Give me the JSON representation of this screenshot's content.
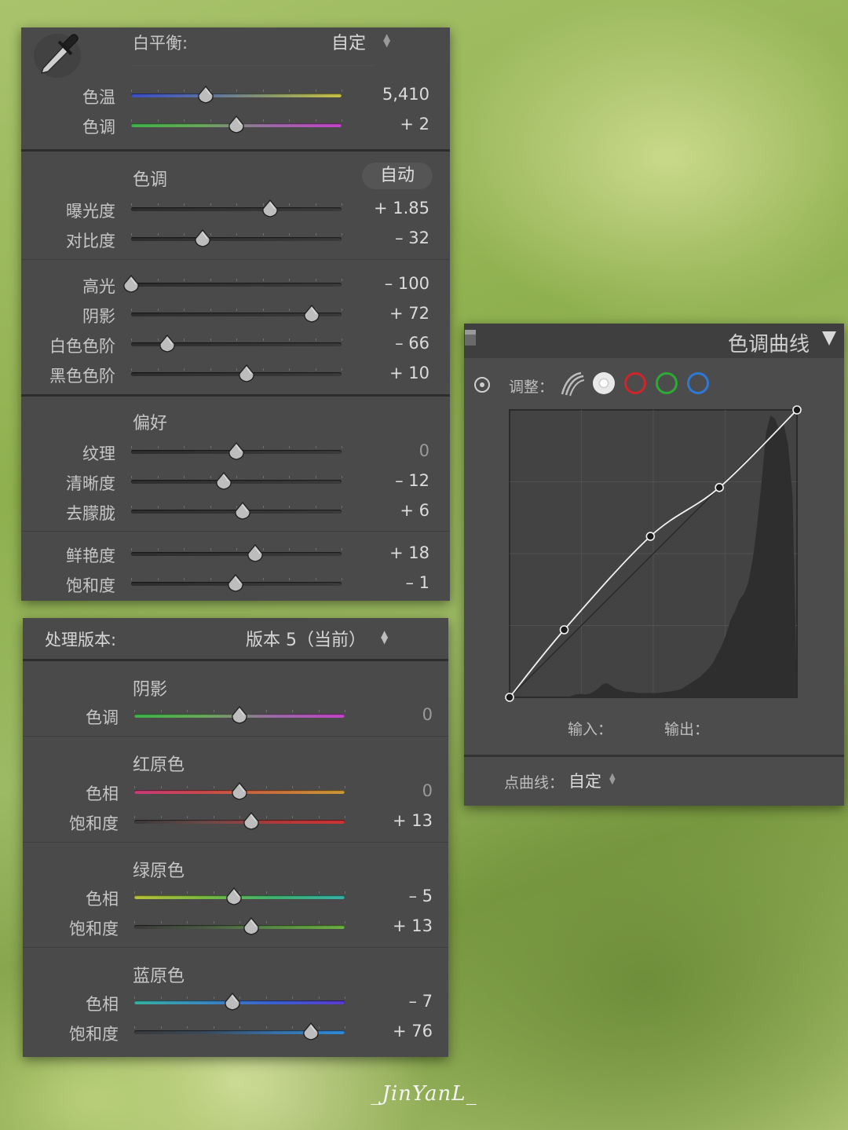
{
  "basic_panel": {
    "white_balance": {
      "label": "白平衡:",
      "value": "自定"
    },
    "wb_rows": [
      {
        "label": "色温",
        "value": "5,410",
        "pos": 0.355,
        "gradient": "linear-gradient(90deg,#3b4fc7,#5a6fa8,#8b9a6a,#c9c245)"
      },
      {
        "label": "色调",
        "value": "+ 2",
        "pos": 0.5,
        "gradient": "linear-gradient(90deg,#3fb24a,#6aa85a,#9b6aa5,#c344c8)"
      }
    ],
    "tone": {
      "title": "色调",
      "auto_button": "自动"
    },
    "tone_rows": [
      {
        "label": "曝光度",
        "value": "+ 1.85",
        "pos": 0.66
      },
      {
        "label": "对比度",
        "value": "– 32",
        "pos": 0.34
      }
    ],
    "tone_rows2": [
      {
        "label": "高光",
        "value": "– 100",
        "pos": 0.0
      },
      {
        "label": "阴影",
        "value": "+ 72",
        "pos": 0.86
      },
      {
        "label": "白色色阶",
        "value": "– 66",
        "pos": 0.17
      },
      {
        "label": "黑色色阶",
        "value": "+ 10",
        "pos": 0.55
      }
    ],
    "presence": {
      "title": "偏好"
    },
    "presence_rows": [
      {
        "label": "纹理",
        "value": "0",
        "pos": 0.5,
        "muted": true
      },
      {
        "label": "清晰度",
        "value": "– 12",
        "pos": 0.44
      },
      {
        "label": "去朦胧",
        "value": "+ 6",
        "pos": 0.53
      }
    ],
    "presence_rows2": [
      {
        "label": "鲜艳度",
        "value": "+ 18",
        "pos": 0.59
      },
      {
        "label": "饱和度",
        "value": "– 1",
        "pos": 0.495
      }
    ]
  },
  "calibration_panel": {
    "process": {
      "label": "处理版本:",
      "value": "版本 5（当前）"
    },
    "shadows": {
      "title": "阴影",
      "rows": [
        {
          "label": "色调",
          "value": "0",
          "pos": 0.5,
          "muted": true,
          "gradient": "linear-gradient(90deg,#3fb24a,#6aa85a,#9b6aa5,#c344c8)"
        }
      ]
    },
    "red": {
      "title": "红原色",
      "rows": [
        {
          "label": "色相",
          "value": "0",
          "pos": 0.5,
          "muted": true,
          "gradient": "linear-gradient(90deg,#c83a78,#c84a4a,#c9703a,#c99a35)"
        },
        {
          "label": "饱和度",
          "value": "+ 13",
          "pos": 0.555,
          "gradient": "linear-gradient(90deg,#3a3a3a,#6a4a4a,#b03a3a,#d13232)"
        }
      ]
    },
    "green": {
      "title": "绿原色",
      "rows": [
        {
          "label": "色相",
          "value": "– 5",
          "pos": 0.475,
          "gradient": "linear-gradient(90deg,#b9c03a,#7ab842,#3fb070,#36b0a6)"
        },
        {
          "label": "饱和度",
          "value": "+ 13",
          "pos": 0.555,
          "gradient": "linear-gradient(90deg,#3a3a3a,#4a5a44,#5a8a46,#6bb040)"
        }
      ]
    },
    "blue": {
      "title": "蓝原色",
      "rows": [
        {
          "label": "色相",
          "value": "– 7",
          "pos": 0.465,
          "gradient": "linear-gradient(90deg,#36b0a0,#3a8ac0,#3a60d0,#5a3ad0)"
        },
        {
          "label": "饱和度",
          "value": "+ 76",
          "pos": 0.84,
          "gradient": "linear-gradient(90deg,#3a3a3a,#3a4a5a,#3a70a6,#2e8ad8)"
        }
      ]
    }
  },
  "curve_panel": {
    "title": "色调曲线",
    "adjust_label": "调整：",
    "input_label": "输入：",
    "output_label": "输出：",
    "point_curve_label": "点曲线：",
    "point_curve_value": "自定",
    "channel_colors": [
      "#e8e8e8",
      "#d0252a",
      "#2ea836",
      "#2f78d6"
    ],
    "curve_points": [
      [
        0,
        0
      ],
      [
        0.19,
        0.235
      ],
      [
        0.49,
        0.56
      ],
      [
        0.73,
        0.73
      ],
      [
        1.0,
        1.0
      ]
    ]
  },
  "watermark": "_JinYanL_"
}
